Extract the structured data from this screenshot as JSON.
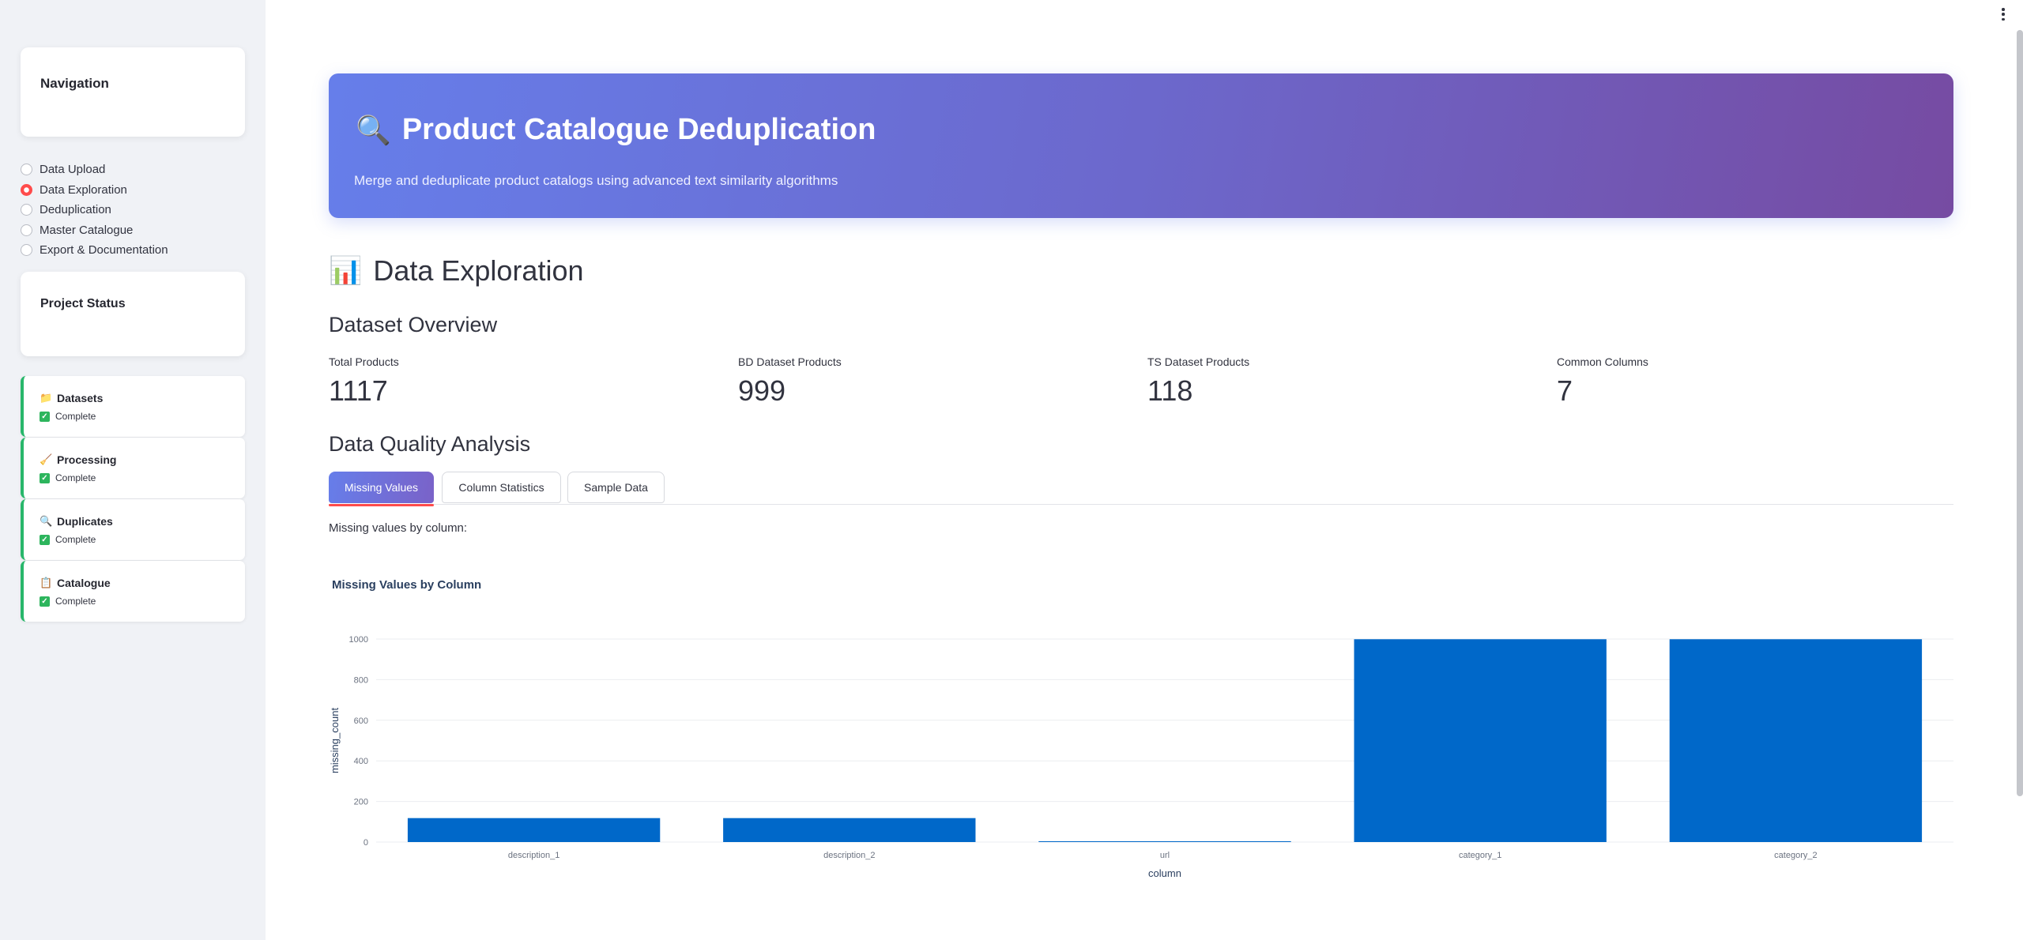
{
  "sidebar": {
    "navigation_title": "Navigation",
    "nav_options": [
      {
        "label": "Data Upload",
        "selected": false
      },
      {
        "label": "Data Exploration",
        "selected": true
      },
      {
        "label": "Deduplication",
        "selected": false
      },
      {
        "label": "Master Catalogue",
        "selected": false
      },
      {
        "label": "Export & Documentation",
        "selected": false
      }
    ],
    "status_title": "Project Status",
    "status_items": [
      {
        "icon": "folder-icon",
        "glyph": "📁",
        "label": "Datasets",
        "status": "Complete"
      },
      {
        "icon": "broom-icon",
        "glyph": "🧹",
        "label": "Processing",
        "status": "Complete"
      },
      {
        "icon": "magnifier-icon",
        "glyph": "🔍",
        "label": "Duplicates",
        "status": "Complete"
      },
      {
        "icon": "clipboard-icon",
        "glyph": "📋",
        "label": "Catalogue",
        "status": "Complete"
      }
    ]
  },
  "hero": {
    "icon": "magnifier-icon",
    "glyph": "🔍",
    "title": "Product Catalogue Deduplication",
    "subtitle": "Merge and deduplicate product catalogs using advanced text similarity algorithms"
  },
  "page": {
    "icon": "bar-chart-icon",
    "glyph": "📊",
    "title": "Data Exploration",
    "overview_heading": "Dataset Overview",
    "quality_heading": "Data Quality Analysis",
    "caption": "Missing values by column:"
  },
  "metrics": [
    {
      "label": "Total Products",
      "value": "1117"
    },
    {
      "label": "BD Dataset Products",
      "value": "999"
    },
    {
      "label": "TS Dataset Products",
      "value": "118"
    },
    {
      "label": "Common Columns",
      "value": "7"
    }
  ],
  "tabs": [
    {
      "label": "Missing Values",
      "active": true
    },
    {
      "label": "Column Statistics",
      "active": false
    },
    {
      "label": "Sample Data",
      "active": false
    }
  ],
  "colors": {
    "accent": "#ff4b4b",
    "bar": "#0068c9",
    "status_border": "#28b76b",
    "hero_start": "#667eea",
    "hero_end": "#764ba2"
  },
  "chart_data": {
    "type": "bar",
    "title": "Missing Values by Column",
    "xlabel": "column",
    "ylabel": "missing_count",
    "categories": [
      "description_1",
      "description_2",
      "url",
      "category_1",
      "category_2"
    ],
    "values": [
      118,
      118,
      1,
      999,
      999
    ],
    "ylim": [
      0,
      1000
    ],
    "yticks": [
      0,
      200,
      400,
      600,
      800,
      1000
    ],
    "grid": true
  }
}
